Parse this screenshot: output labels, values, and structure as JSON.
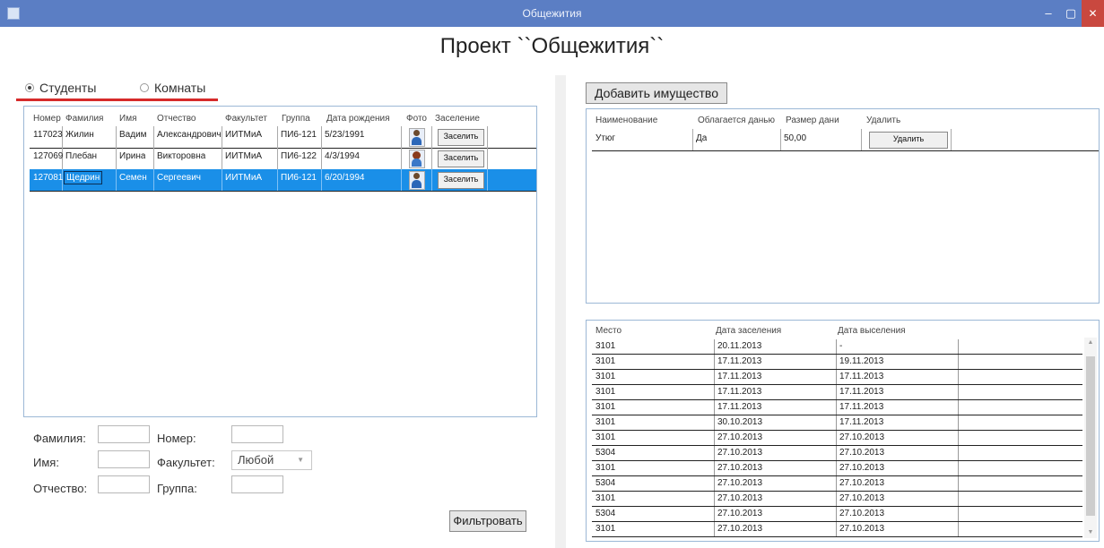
{
  "window": {
    "title": "Общежития",
    "minimize": "–",
    "maximize": "▢",
    "close": "✕"
  },
  "project_title": "Проект ``Общежития``",
  "view_switch": {
    "students_label": "Студенты",
    "rooms_label": "Комнаты",
    "selected": "students"
  },
  "students_grid": {
    "headers": [
      "Номер",
      "Фамилия",
      "Имя",
      "Отчество",
      "Факультет",
      "Группа",
      "Дата рождения",
      "Фото",
      "Заселение"
    ],
    "rows": [
      {
        "number": "117023",
        "surname": "Жилин",
        "name": "Вадим",
        "patronymic": "Александрович",
        "faculty": "ИИТМиА",
        "group": "ПИ6-121",
        "birth_date": "5/23/1991",
        "photo": "male-student-icon",
        "action": "Заселить"
      },
      {
        "number": "127069",
        "surname": "Плебан",
        "name": "Ирина",
        "patronymic": "Викторовна",
        "faculty": "ИИТМиА",
        "group": "ПИ6-122",
        "birth_date": "4/3/1994",
        "photo": "female-student-icon",
        "action": "Заселить"
      },
      {
        "number": "127081",
        "surname": "Щедрин",
        "name": "Семен",
        "patronymic": "Сергеевич",
        "faculty": "ИИТМиА",
        "group": "ПИ6-121",
        "birth_date": "6/20/1994",
        "photo": "male-student-icon",
        "action": "Заселить",
        "selected": true
      }
    ]
  },
  "filter": {
    "surname_label": "Фамилия:",
    "name_label": "Имя:",
    "patronymic_label": "Отчество:",
    "number_label": "Номер:",
    "faculty_label": "Факультет:",
    "group_label": "Группа:",
    "faculty_value": "Любой",
    "surname_value": "",
    "name_value": "",
    "patronymic_value": "",
    "number_value": "",
    "group_value": "",
    "button": "Фильтровать"
  },
  "property": {
    "add_button": "Добавить имущество",
    "headers": [
      "Наименование",
      "Облагается данью",
      "Размер дани",
      "Удалить"
    ],
    "rows": [
      {
        "name": "Утюг",
        "taxed": "Да",
        "amount": "50,00",
        "action": "Удалить"
      }
    ]
  },
  "stays": {
    "headers": [
      "Место",
      "Дата заселения",
      "Дата выселения"
    ],
    "rows": [
      [
        "3101",
        "20.11.2013",
        "-"
      ],
      [
        "3101",
        "17.11.2013",
        "19.11.2013"
      ],
      [
        "3101",
        "17.11.2013",
        "17.11.2013"
      ],
      [
        "3101",
        "17.11.2013",
        "17.11.2013"
      ],
      [
        "3101",
        "17.11.2013",
        "17.11.2013"
      ],
      [
        "3101",
        "30.10.2013",
        "17.11.2013"
      ],
      [
        "3101",
        "27.10.2013",
        "27.10.2013"
      ],
      [
        "5304",
        "27.10.2013",
        "27.10.2013"
      ],
      [
        "3101",
        "27.10.2013",
        "27.10.2013"
      ],
      [
        "5304",
        "27.10.2013",
        "27.10.2013"
      ],
      [
        "3101",
        "27.10.2013",
        "27.10.2013"
      ],
      [
        "5304",
        "27.10.2013",
        "27.10.2013"
      ],
      [
        "3101",
        "27.10.2013",
        "27.10.2013"
      ]
    ]
  }
}
